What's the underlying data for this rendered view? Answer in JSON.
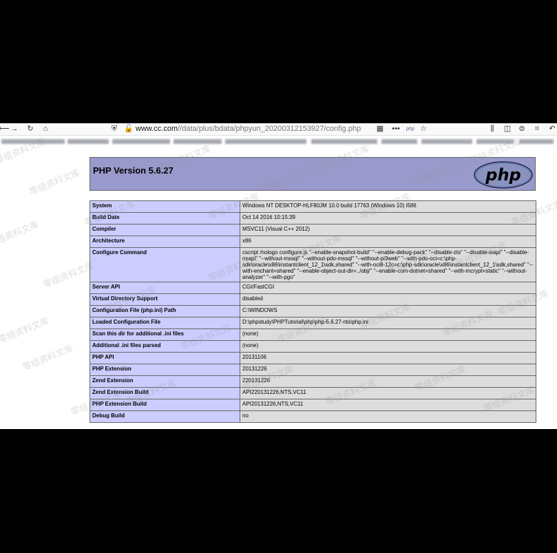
{
  "browser": {
    "url_host": "www.cc.com",
    "url_path": "//data/plus/bdata/phpyun_20200312153927/config.php",
    "icons": [
      "back-icon",
      "forward-icon",
      "reload-icon",
      "home-icon",
      "shield-icon",
      "insecure-lock-icon",
      "qr-code-icon",
      "more-icon",
      "php-extension-icon",
      "bookmark-star-icon",
      "library-icon",
      "sidebar-icon",
      "account-icon",
      "screenshot-icon",
      "undo-icon"
    ],
    "ext_label": "php"
  },
  "phpinfo": {
    "version": "PHP Version 5.6.27",
    "logo_text": "php",
    "colors": {
      "header": "#9999cc",
      "key_cell": "#ccccff",
      "value_cell": "#dddddd"
    },
    "rows": [
      {
        "key": "System",
        "value": "Windows NT DESKTOP-HLF80JM 10.0 build 17763 (Windows 10) i586"
      },
      {
        "key": "Build Date",
        "value": "Oct 14 2016 10:15:39"
      },
      {
        "key": "Compiler",
        "value": "MSVC11 (Visual C++ 2012)"
      },
      {
        "key": "Architecture",
        "value": "x86"
      },
      {
        "key": "Configure Command",
        "value": "cscript /nologo configure.js \"--enable-snapshot-build\" \"--enable-debug-pack\" \"--disable-zts\" \"--disable-isapi\" \"--disable-nsapi\" \"--without-mssql\" \"--without-pdo-mssql\" \"--without-pi3web\" \"--with-pdo-oci=c:\\php-sdk\\oracle\\x86\\instantclient_12_1\\sdk,shared\" \"--with-oci8-12c=c:\\php-sdk\\oracle\\x86\\instantclient_12_1\\sdk,shared\" \"--with-enchant=shared\" \"--enable-object-out-dir=../obj/\" \"--enable-com-dotnet=shared\" \"--with-mcrypt=static\" \"--without-analyzer\" \"--with-pgo\""
      },
      {
        "key": "Server API",
        "value": "CGI/FastCGI"
      },
      {
        "key": "Virtual Directory Support",
        "value": "disabled"
      },
      {
        "key": "Configuration File (php.ini) Path",
        "value": "C:\\WINDOWS"
      },
      {
        "key": "Loaded Configuration File",
        "value": "D:\\phpstudy\\PHPTutorial\\php\\php-5.6.27-nts\\php.ini"
      },
      {
        "key": "Scan this dir for additional .ini files",
        "value": "(none)"
      },
      {
        "key": "Additional .ini files parsed",
        "value": "(none)"
      },
      {
        "key": "PHP API",
        "value": "20131106"
      },
      {
        "key": "PHP Extension",
        "value": "20131226"
      },
      {
        "key": "Zend Extension",
        "value": "220131226"
      },
      {
        "key": "Zend Extension Build",
        "value": "API220131226,NTS,VC11"
      },
      {
        "key": "PHP Extension Build",
        "value": "API20131226,NTS,VC11"
      },
      {
        "key": "Debug Build",
        "value": "no"
      }
    ]
  },
  "watermark": "零组资料文库"
}
